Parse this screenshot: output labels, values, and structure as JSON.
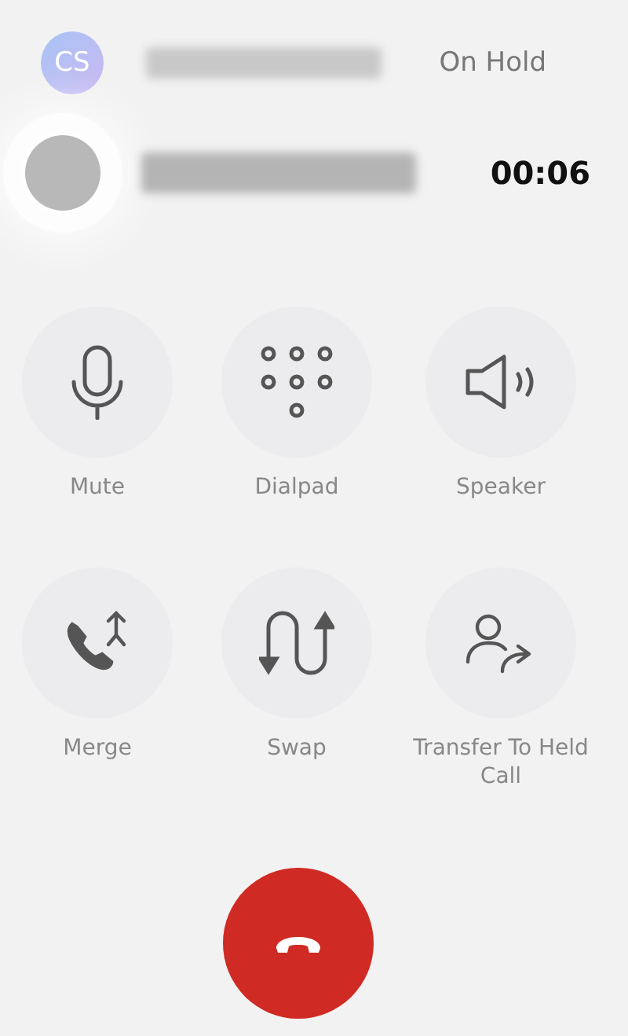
{
  "held_call": {
    "initials": "CS",
    "status": "On Hold"
  },
  "active_call": {
    "timer": "00:06"
  },
  "actions": [
    {
      "kind": "mic",
      "label": "Mute"
    },
    {
      "kind": "dialpad",
      "label": "Dialpad"
    },
    {
      "kind": "speaker",
      "label": "Speaker"
    },
    {
      "kind": "merge",
      "label": "Merge"
    },
    {
      "kind": "swap",
      "label": "Swap"
    },
    {
      "kind": "transfer",
      "label": "Transfer To Held Call"
    }
  ]
}
